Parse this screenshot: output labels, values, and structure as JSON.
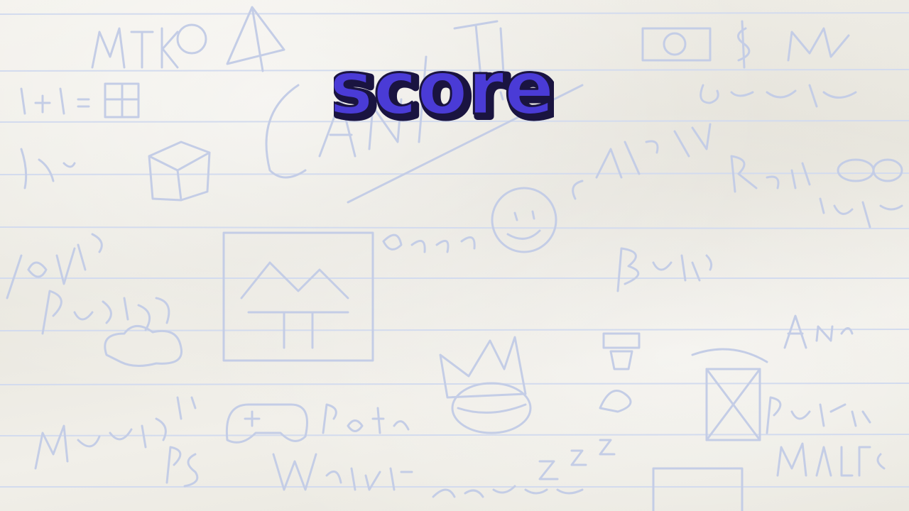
{
  "screen": {
    "title": "score"
  },
  "colors": {
    "title_fill": "#4a3bd6",
    "title_outline": "#1a1440",
    "paper": "#efede6",
    "doodle_ink": "#c4cde6"
  },
  "background": {
    "doodle_icons": [
      "paper-airplane-icon",
      "house-drawing-icon",
      "crown-icon",
      "gamepad-icon",
      "smiley-face-icon",
      "cube-icon"
    ]
  }
}
